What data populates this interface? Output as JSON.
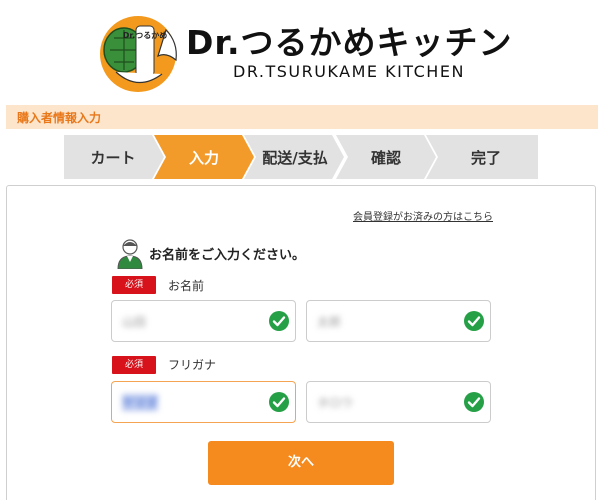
{
  "brand": {
    "title": "Dr.つるかめキッチン",
    "subtitle": "DR.TSURUKAME KITCHEN",
    "logo_text": "Dr.つるかめ"
  },
  "section_title": "購入者情報入力",
  "steps": [
    {
      "label": "カート",
      "active": false
    },
    {
      "label": "入力",
      "active": true
    },
    {
      "label": "配送/支払",
      "active": false
    },
    {
      "label": "確認",
      "active": false
    },
    {
      "label": "完了",
      "active": false
    }
  ],
  "form": {
    "member_link": "会員登録がお済みの方はこちら",
    "prompt": "お名前をご入力ください。",
    "required_badge": "必須",
    "name_label": "お名前",
    "kana_label": "フリガナ",
    "name_last": "山田",
    "name_first": "太郎",
    "kana_last": "ヤマダ",
    "kana_first": "タロウ",
    "next_button": "次へ"
  },
  "colors": {
    "accent": "#f58a1f",
    "step_active": "#f29b2b",
    "step_inactive": "#e2e2e2",
    "required": "#d7121b",
    "check": "#25a047",
    "section_bg": "#fde5cc"
  }
}
